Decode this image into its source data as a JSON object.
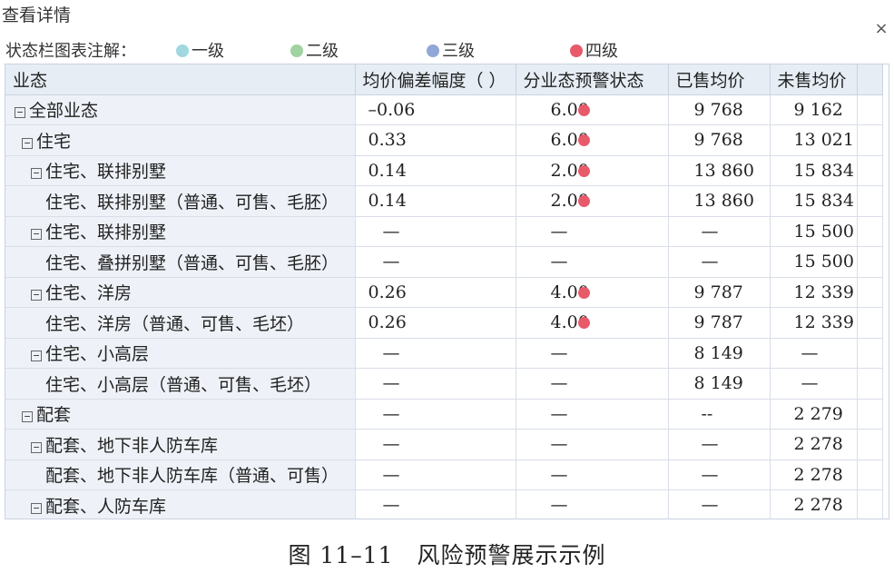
{
  "dialog": {
    "title": "查看详情",
    "close_label": "×"
  },
  "legend": {
    "label": "状态栏图表注解：",
    "items": [
      {
        "label": "一级",
        "color": "#9fd8df"
      },
      {
        "label": "二级",
        "color": "#9fd3a0"
      },
      {
        "label": "三级",
        "color": "#8fa8d8"
      },
      {
        "label": "四级",
        "color": "#e85a6a"
      }
    ]
  },
  "table": {
    "headers": [
      "业态",
      "均价偏差幅度（ ）",
      "分业态预警状态",
      "已售均价",
      "未售均价"
    ],
    "rows": [
      {
        "name": "全部业态",
        "level": 0,
        "tree": true,
        "deviation": "–0.06",
        "status": "6.00",
        "status_level": 4,
        "sold": "9 768",
        "unsold": "9 162"
      },
      {
        "name": "住宅",
        "level": 1,
        "tree": true,
        "deviation": "0.33",
        "status": "6.00",
        "status_level": 4,
        "sold": "9 768",
        "unsold": "13 021"
      },
      {
        "name": "住宅、联排别墅",
        "level": 2,
        "tree": true,
        "deviation": "0.14",
        "status": "2.00",
        "status_level": 4,
        "sold": "13 860",
        "unsold": "15 834"
      },
      {
        "name": "住宅、联排别墅（普通、可售、毛胚）",
        "level": 3,
        "tree": false,
        "deviation": "0.14",
        "status": "2.00",
        "status_level": 4,
        "sold": "13 860",
        "unsold": "15 834"
      },
      {
        "name": "住宅、联排别墅",
        "level": 2,
        "tree": true,
        "deviation": "—",
        "status": "—",
        "status_level": 0,
        "sold": "—",
        "unsold": "15 500"
      },
      {
        "name": "住宅、叠拼别墅（普通、可售、毛胚）",
        "level": 3,
        "tree": false,
        "deviation": "—",
        "status": "—",
        "status_level": 0,
        "sold": "—",
        "unsold": "15 500"
      },
      {
        "name": "住宅、洋房",
        "level": 2,
        "tree": true,
        "deviation": "0.26",
        "status": "4.00",
        "status_level": 4,
        "sold": "9 787",
        "unsold": "12 339"
      },
      {
        "name": "住宅、洋房（普通、可售、毛坯）",
        "level": 3,
        "tree": false,
        "deviation": "0.26",
        "status": "4.00",
        "status_level": 4,
        "sold": "9 787",
        "unsold": "12 339"
      },
      {
        "name": "住宅、小高层",
        "level": 2,
        "tree": true,
        "deviation": "—",
        "status": "—",
        "status_level": 0,
        "sold": "8 149",
        "unsold": "—"
      },
      {
        "name": "住宅、小高层（普通、可售、毛坯）",
        "level": 3,
        "tree": false,
        "deviation": "—",
        "status": "—",
        "status_level": 0,
        "sold": "8 149",
        "unsold": "—"
      },
      {
        "name": "配套",
        "level": 1,
        "tree": true,
        "deviation": "—",
        "status": "—",
        "status_level": 0,
        "sold": "--",
        "unsold": "2 279"
      },
      {
        "name": "配套、地下非人防车库",
        "level": 2,
        "tree": true,
        "deviation": "—",
        "status": "—",
        "status_level": 0,
        "sold": "—",
        "unsold": "2 278"
      },
      {
        "name": "配套、地下非人防车库（普通、可售）",
        "level": 3,
        "tree": false,
        "deviation": "—",
        "status": "—",
        "status_level": 0,
        "sold": "—",
        "unsold": "2 278"
      },
      {
        "name": "配套、人防车库",
        "level": 2,
        "tree": true,
        "deviation": "—",
        "status": "—",
        "status_level": 0,
        "sold": "—",
        "unsold": "2 278"
      }
    ]
  },
  "caption": "图 11–11　风险预警展示示例"
}
